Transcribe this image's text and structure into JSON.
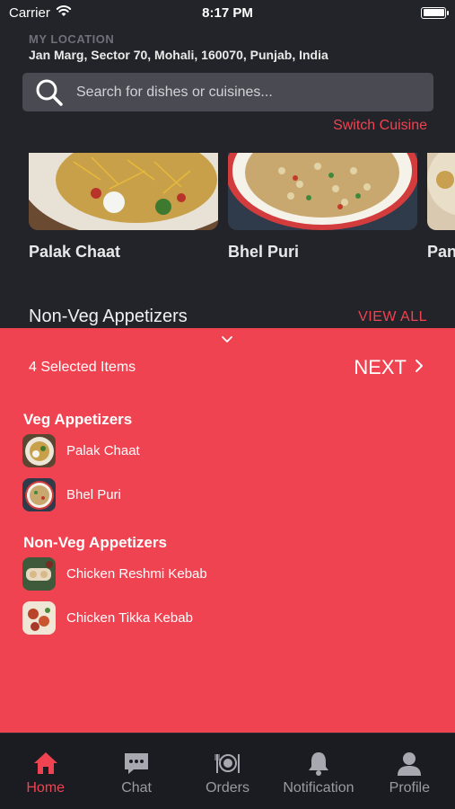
{
  "status_bar": {
    "carrier": "Carrier",
    "time": "8:17 PM"
  },
  "location": {
    "label": "MY LOCATION",
    "address": "Jan Marg, Sector 70, Mohali, 160070, Punjab, India"
  },
  "search": {
    "placeholder": "Search for dishes or cuisines..."
  },
  "switch_cuisine": "Switch Cuisine",
  "dishes": [
    {
      "name": "Palak Chaat"
    },
    {
      "name": "Bhel Puri"
    },
    {
      "name": "Pan"
    }
  ],
  "section": {
    "title": "Non-Veg Appetizers",
    "view_all": "VIEW ALL"
  },
  "selection_sheet": {
    "count_label": "4 Selected Items",
    "next_label": "NEXT",
    "groups": [
      {
        "title": "Veg Appetizers",
        "items": [
          {
            "label": "Palak Chaat"
          },
          {
            "label": "Bhel Puri"
          }
        ]
      },
      {
        "title": "Non-Veg Appetizers",
        "items": [
          {
            "label": "Chicken Reshmi Kebab"
          },
          {
            "label": "Chicken Tikka Kebab"
          }
        ]
      }
    ]
  },
  "tabbar": {
    "active": "Home",
    "tabs": [
      {
        "label": "Home",
        "icon": "home-icon"
      },
      {
        "label": "Chat",
        "icon": "chat-icon"
      },
      {
        "label": "Orders",
        "icon": "orders-icon"
      },
      {
        "label": "Notification",
        "icon": "bell-icon"
      },
      {
        "label": "Profile",
        "icon": "profile-icon"
      }
    ]
  },
  "colors": {
    "accent": "#f04351",
    "background": "#23242a",
    "tabbar": "#1b1c21",
    "search_field": "#4a4b52"
  }
}
